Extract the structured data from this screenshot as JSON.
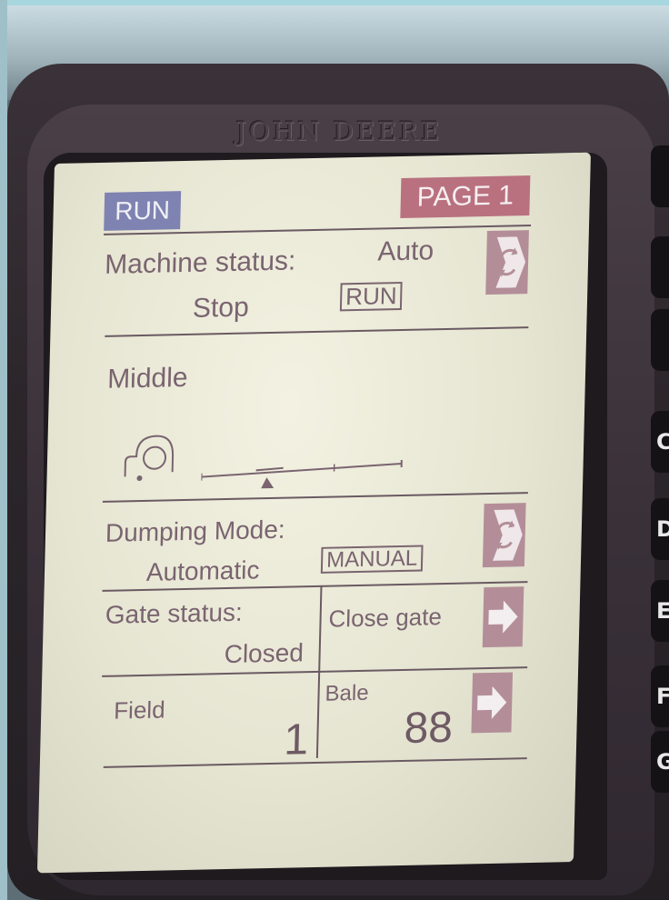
{
  "device": {
    "brand": "JOHN DEERE"
  },
  "header": {
    "run_label": "RUN",
    "page_label": "PAGE 1"
  },
  "machine": {
    "status_label": "Machine status:",
    "status_value": "Auto",
    "stop_label": "Stop",
    "run_box": "RUN"
  },
  "position": {
    "label": "Middle",
    "slider_level": 0.35
  },
  "dumping": {
    "label": "Dumping Mode:",
    "value": "Automatic",
    "mode_box": "MANUAL"
  },
  "gate": {
    "label": "Gate status:",
    "value": "Closed",
    "action": "Close gate"
  },
  "counters": {
    "field_label": "Field",
    "field_value": "1",
    "bale_label": "Bale",
    "bale_value": "88"
  },
  "keys": [
    "C",
    "D",
    "E",
    "F",
    "G"
  ],
  "colors": {
    "screen_bg": "#e6e5d2",
    "run_badge": "#7f83b1",
    "page_badge": "#b9717f",
    "softkey": "#b38e98",
    "lcd_text": "#7a6470"
  },
  "icons": {
    "cycle_button": "cycle-arrows-icon",
    "next_button": "right-arrow-icon",
    "bale_chamber": "bale-chamber-icon"
  }
}
